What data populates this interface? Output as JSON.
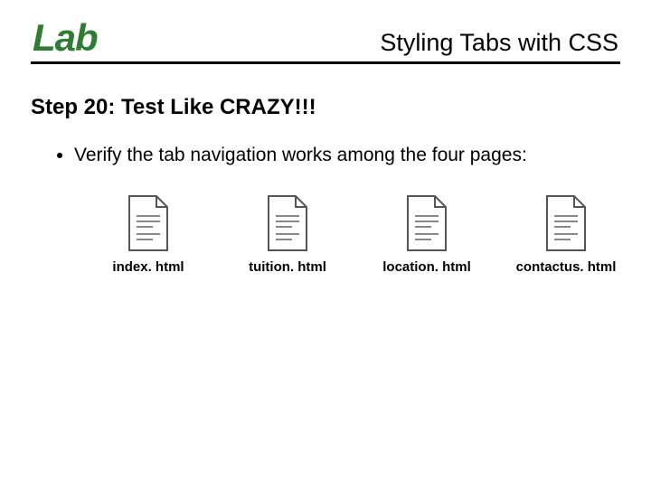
{
  "header": {
    "lab_label": "Lab",
    "title": "Styling Tabs with CSS"
  },
  "step_heading": "Step 20: Test Like CRAZY!!!",
  "bullet_text": "Verify the tab navigation works among the four pages:",
  "files": [
    {
      "name": "index. html"
    },
    {
      "name": "tuition. html"
    },
    {
      "name": "location. html"
    },
    {
      "name": "contactus. html"
    }
  ]
}
